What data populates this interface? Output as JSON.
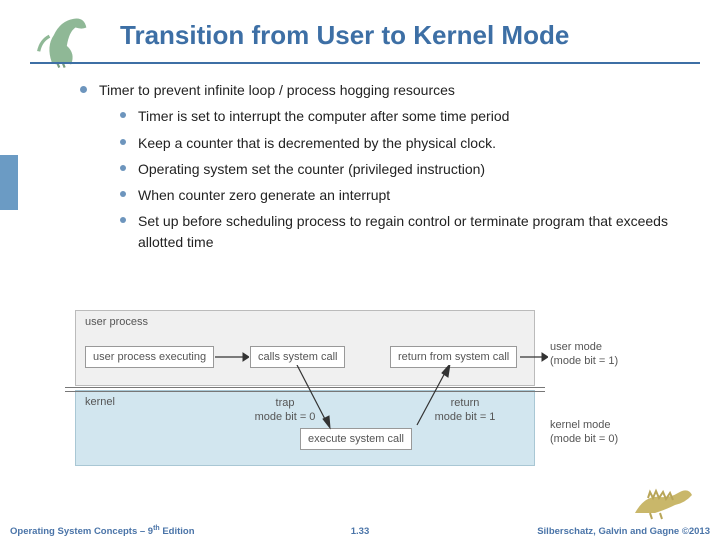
{
  "title": "Transition from User to Kernel Mode",
  "bullets": {
    "main": "Timer to prevent infinite loop / process hogging resources",
    "sub": [
      "Timer is set to interrupt the computer after some time period",
      "Keep a counter that is decremented by the physical clock.",
      "Operating system set the counter (privileged instruction)",
      "When counter zero generate an interrupt",
      "Set up before scheduling process to regain control or terminate program that exceeds allotted time"
    ]
  },
  "diagram": {
    "upper": "user process",
    "lower": "kernel",
    "box_exec": "user process executing",
    "box_call": "calls system call",
    "box_return": "return from system call",
    "box_execute_syscall": "execute system call",
    "annot_trap": "trap\nmode bit = 0",
    "annot_return": "return\nmode bit = 1",
    "side_user": "user mode\n(mode bit = 1)",
    "side_kernel": "kernel mode\n(mode bit = 0)"
  },
  "footer": {
    "left_a": "Operating System Concepts – 9",
    "left_b": " Edition",
    "left_sup": "th",
    "center": "1.33",
    "right": "Silberschatz, Galvin and Gagne ©2013"
  }
}
